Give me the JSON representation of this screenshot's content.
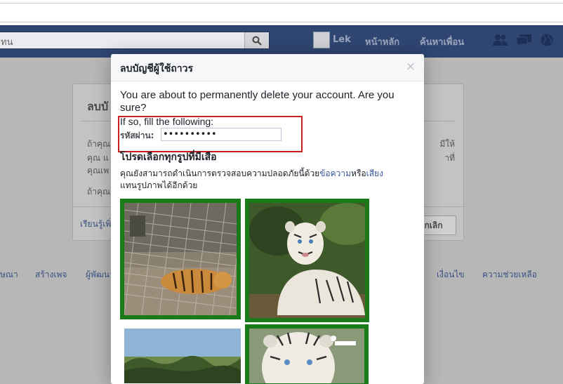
{
  "topbar": {
    "search_text": "ทน",
    "user_name": "Lek",
    "home_label": "หน้าหลัก",
    "find_friends_label": "ค้นหาเพื่อน"
  },
  "background": {
    "card_title": "ลบบั",
    "lines": [
      "ถ้าคุณ",
      "คุณ แ",
      "คุณเพ",
      "ถ้าคุณ"
    ],
    "right_lines": [
      "มีให้",
      "าที่"
    ],
    "learn_more": "เรียนรู้เพิ่ม",
    "cancel_label": "ยกเลิก",
    "footer": [
      "ษณา",
      "สร้างเพจ",
      "ผู้พัฒนา",
      "เงื่อนไข",
      "ความช่วยเหลือ"
    ]
  },
  "modal": {
    "title": "ลบบัญชีผู้ใช้ถาวร",
    "close": "×",
    "message": "You are about to permanently delete your account. Are you sure?",
    "fill_text": "If so, fill the following:",
    "password_label": "รหัสผ่าน:",
    "password_value": "••••••••••",
    "select_heading": "โปรดเลือกทุกรูปที่มีเสือ",
    "hint_before": "คุณยังสามารถดำเนินการตรวจสอบความปลอดภัยนี้ด้วย",
    "hint_link1": "ข้อความ",
    "hint_mid": "หรือ",
    "hint_link2": "เสียง",
    "hint_after": "แทนรูปภาพได้อีกด้วย",
    "photos": [
      {
        "name": "tiger-in-cage",
        "selected": true
      },
      {
        "name": "white-tiger-lying",
        "selected": true
      },
      {
        "name": "landscape-trees",
        "selected": false
      },
      {
        "name": "white-tiger-face",
        "selected": true
      }
    ]
  },
  "colors": {
    "fb_blue": "#2f4673",
    "select_green": "#1a7a1a",
    "highlight_red": "#cc1f1f",
    "link": "#365899"
  }
}
